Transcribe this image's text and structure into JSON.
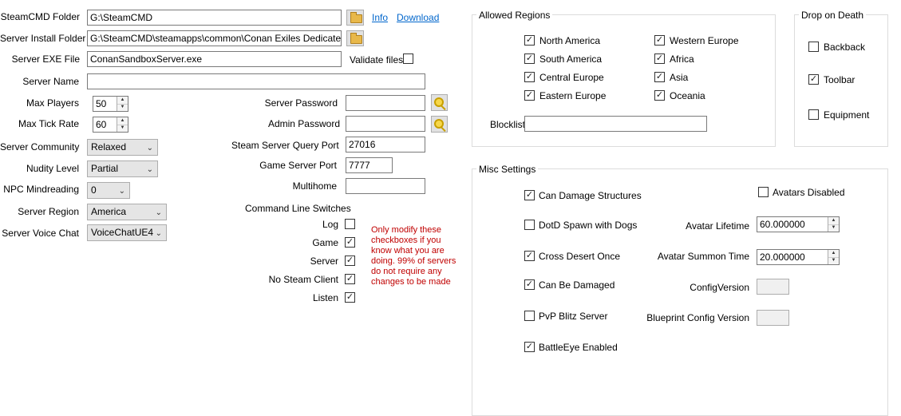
{
  "paths": {
    "steamcmd_folder_label": "SteamCMD Folder",
    "steamcmd_folder_value": "G:\\SteamCMD",
    "info_link": "Info",
    "download_link": "Download",
    "install_folder_label": "Server Install Folder",
    "install_folder_value": "G:\\SteamCMD\\steamapps\\common\\Conan Exiles Dedicated Serv",
    "exe_label": "Server EXE File",
    "exe_value": "ConanSandboxServer.exe",
    "validate_label": "Validate files",
    "validate_checked": false
  },
  "server": {
    "name_label": "Server Name",
    "name_value": "",
    "max_players_label": "Max Players",
    "max_players_value": "50",
    "max_tick_label": "Max Tick Rate",
    "max_tick_value": "60",
    "community_label": "Server Community",
    "community_value": "Relaxed",
    "nudity_label": "Nudity Level",
    "nudity_value": "Partial",
    "npc_label": "NPC Mindreading",
    "npc_value": "0",
    "region_label": "Server Region",
    "region_value": "America",
    "voice_label": "Server Voice Chat",
    "voice_value": "VoiceChatUE4"
  },
  "network": {
    "server_password_label": "Server Password",
    "server_password_value": "",
    "admin_password_label": "Admin Password",
    "admin_password_value": "",
    "query_port_label": "Steam Server Query Port",
    "query_port_value": "27016",
    "game_port_label": "Game Server Port",
    "game_port_value": "7777",
    "multihome_label": "Multihome",
    "multihome_value": ""
  },
  "switches": {
    "title": "Command Line Switches",
    "items": [
      {
        "label": "Log",
        "checked": false
      },
      {
        "label": "Game",
        "checked": true
      },
      {
        "label": "Server",
        "checked": true
      },
      {
        "label": "No Steam Client",
        "checked": true
      },
      {
        "label": "Listen",
        "checked": true
      }
    ],
    "warning": "Only modify these\ncheckboxes if you\nknow what you are\ndoing.  99% of servers\ndo not require any\nchanges to be made"
  },
  "regions": {
    "title": "Allowed Regions",
    "items": [
      {
        "label": "North America",
        "checked": true
      },
      {
        "label": "South America",
        "checked": true
      },
      {
        "label": "Central Europe",
        "checked": true
      },
      {
        "label": "Eastern Europe",
        "checked": true
      },
      {
        "label": "Western Europe",
        "checked": true
      },
      {
        "label": "Africa",
        "checked": true
      },
      {
        "label": "Asia",
        "checked": true
      },
      {
        "label": "Oceania",
        "checked": true
      }
    ],
    "blocklist_label": "Blocklist",
    "blocklist_value": ""
  },
  "drop": {
    "title": "Drop on Death",
    "items": [
      {
        "label": "Backback",
        "checked": false
      },
      {
        "label": "Toolbar",
        "checked": true
      },
      {
        "label": "Equipment",
        "checked": false
      }
    ]
  },
  "misc": {
    "title": "Misc Settings",
    "items": [
      {
        "label": "Can Damage Structures",
        "checked": true
      },
      {
        "label": "DotD Spawn with Dogs",
        "checked": false
      },
      {
        "label": "Cross Desert Once",
        "checked": true
      },
      {
        "label": "Can Be Damaged",
        "checked": true
      },
      {
        "label": "PvP Blitz Server",
        "checked": false
      },
      {
        "label": "BattleEye Enabled",
        "checked": true
      }
    ],
    "avatars_disabled_label": "Avatars Disabled",
    "avatars_disabled_checked": false,
    "avatar_lifetime_label": "Avatar Lifetime",
    "avatar_lifetime_value": "60.000000",
    "avatar_summon_label": "Avatar Summon Time",
    "avatar_summon_value": "20.000000",
    "config_version_label": "ConfigVersion",
    "config_version_value": "",
    "blueprint_version_label": "Blueprint Config Version",
    "blueprint_version_value": ""
  }
}
